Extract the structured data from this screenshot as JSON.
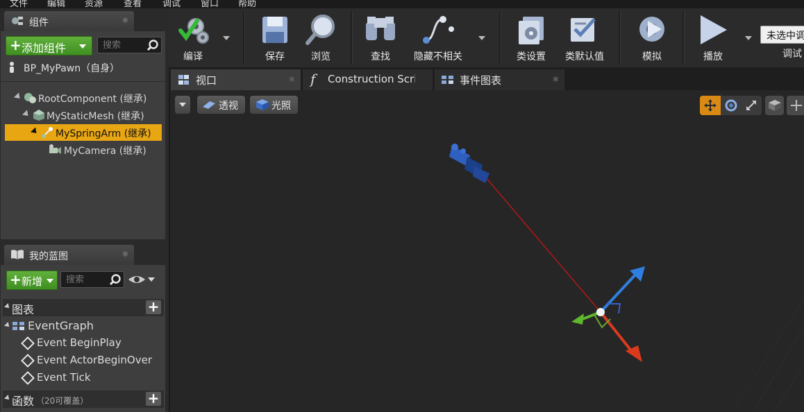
{
  "menu": [
    "文件",
    "编辑",
    "资源",
    "查看",
    "调试",
    "窗口",
    "帮助"
  ],
  "components_panel": {
    "title": "组件",
    "add_button": "添加组件",
    "search_placeholder": "搜索",
    "self_item": "BP_MyPawn（自身）",
    "tree": [
      {
        "label": "RootComponent (继承)",
        "icon": "scene-root-icon"
      },
      {
        "label": "MyStaticMesh (继承)",
        "icon": "static-mesh-icon"
      },
      {
        "label": "MySpringArm (继承)",
        "icon": "spring-arm-icon",
        "selected": true
      },
      {
        "label": "MyCamera (继承)",
        "icon": "camera-icon"
      }
    ]
  },
  "my_blueprint_panel": {
    "title": "我的蓝图",
    "new_button": "新增",
    "search_placeholder": "搜索",
    "graphs_header": "图表",
    "event_graph": "EventGraph",
    "events": [
      "Event BeginPlay",
      "Event ActorBeginOver",
      "Event Tick"
    ],
    "functions_header": "函数",
    "functions_override": "（20可覆盖）"
  },
  "toolbar": {
    "compile": "编译",
    "save": "保存",
    "browse": "浏览",
    "find": "查找",
    "hide_unrelated": "隐藏不相关",
    "class_settings": "类设置",
    "class_defaults": "类默认值",
    "simulate": "模拟",
    "play": "播放",
    "debug_object": "未选中调",
    "debug_label": "调试"
  },
  "doc_tabs": [
    "视口",
    "Construction Scrip",
    "事件图表"
  ],
  "viewport": {
    "perspective": "透视",
    "lit": "光照"
  },
  "colors": {
    "accent_selection": "#e8a613",
    "add_green": "#4f9f2c",
    "gizmo_x": "#d93a1e",
    "gizmo_y": "#5fb82c",
    "gizmo_z": "#2e7fe0"
  }
}
